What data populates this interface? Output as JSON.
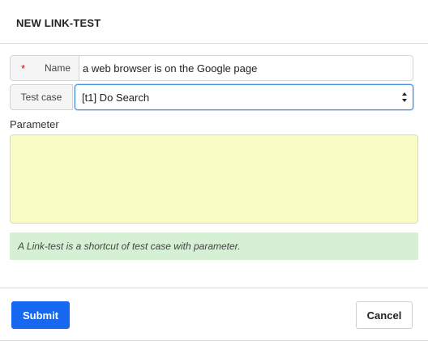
{
  "dialog": {
    "title": "NEW LINK-TEST"
  },
  "form": {
    "name": {
      "required_mark": "*",
      "label": "Name",
      "value": "a web browser is on the Google page"
    },
    "test_case": {
      "label": "Test case",
      "selected": "[t1] Do Search"
    },
    "parameter": {
      "label": "Parameter",
      "value": ""
    },
    "info": "A Link-test is a shortcut of test case with parameter."
  },
  "footer": {
    "submit_label": "Submit",
    "cancel_label": "Cancel"
  },
  "colors": {
    "primary": "#1668f0",
    "parameter_bg": "#fafcc6",
    "info_bg": "#d6f0d6",
    "required": "#d0021b"
  },
  "icons": {
    "select_arrow": "updown-chevron-icon"
  }
}
